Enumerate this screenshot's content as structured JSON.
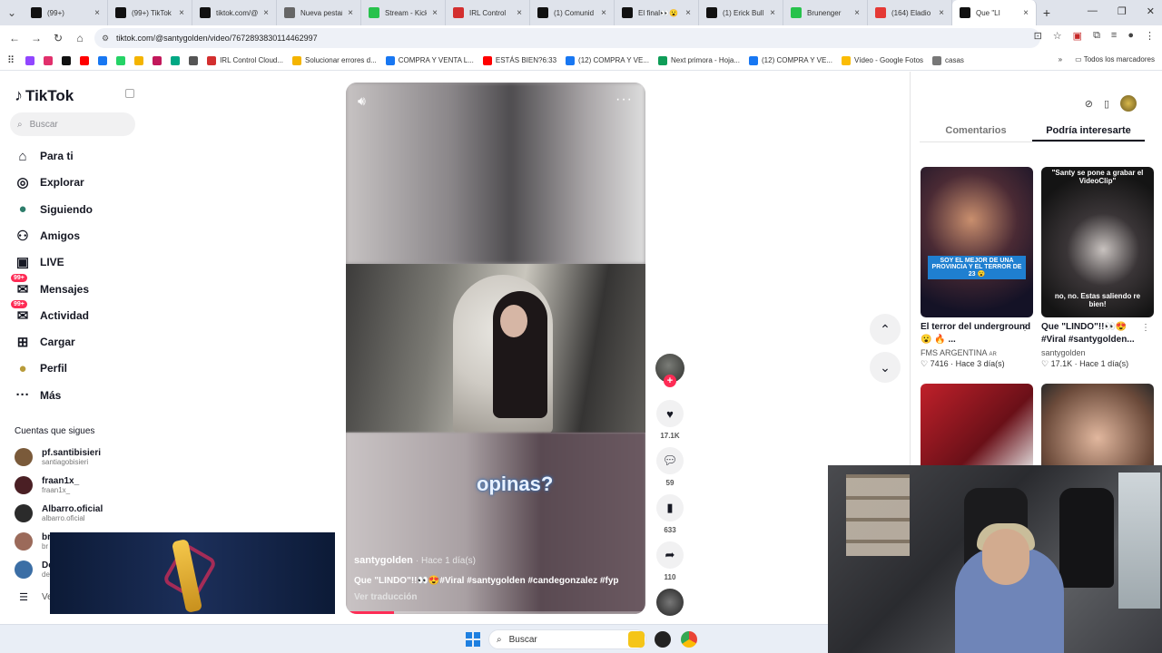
{
  "browser": {
    "tabs": [
      {
        "label": "(99+)",
        "color": "#111"
      },
      {
        "label": "(99+) TikTok",
        "color": "#111"
      },
      {
        "label": "tiktok.com/@",
        "color": "#111"
      },
      {
        "label": "Nueva pestaña",
        "color": "#666"
      },
      {
        "label": "Stream - Kick",
        "color": "#27c24c"
      },
      {
        "label": "IRL Control",
        "color": "#d32f2f"
      },
      {
        "label": "(1) Comunid",
        "color": "#111"
      },
      {
        "label": "El final👀😮",
        "color": "#111"
      },
      {
        "label": "(1) Erick Bull",
        "color": "#111"
      },
      {
        "label": "Brunenger",
        "color": "#27c24c"
      },
      {
        "label": "(164) Eladio",
        "color": "#e53935"
      },
      {
        "label": "Que \"LI",
        "color": "#111",
        "active": true
      }
    ],
    "url": "tiktok.com/@santygolden/video/7672893830114462997",
    "bookmarks": [
      {
        "label": "",
        "color": "#9146ff"
      },
      {
        "label": "",
        "color": "#e1306c"
      },
      {
        "label": "",
        "color": "#111"
      },
      {
        "label": "",
        "color": "#ff0000"
      },
      {
        "label": "",
        "color": "#1877f2"
      },
      {
        "label": "",
        "color": "#25d366"
      },
      {
        "label": "",
        "color": "#f4b400"
      },
      {
        "label": "",
        "color": "#c2185b"
      },
      {
        "label": "",
        "color": "#00a884"
      },
      {
        "label": "",
        "color": "#555"
      },
      {
        "label": "IRL Control Cloud...",
        "color": "#d32f2f"
      },
      {
        "label": "Solucionar errores d...",
        "color": "#f4b400"
      },
      {
        "label": "COMPRA Y VENTA L...",
        "color": "#1877f2"
      },
      {
        "label": "ESTÁS BIEN?6:33",
        "color": "#ff0000"
      },
      {
        "label": "(12) COMPRA Y VE...",
        "color": "#1877f2"
      },
      {
        "label": "Next primora - Hoja...",
        "color": "#0f9d58"
      },
      {
        "label": "(12) COMPRA Y VE...",
        "color": "#1877f2"
      },
      {
        "label": "Vídeo - Google Fotos",
        "color": "#fbbc04"
      },
      {
        "label": "casas",
        "color": "#777"
      }
    ],
    "bookmarks_all": "Todos los marcadores"
  },
  "sidebar": {
    "logo": "TikTok",
    "search_placeholder": "Buscar",
    "nav": [
      {
        "label": "Para ti",
        "icon": "home-icon"
      },
      {
        "label": "Explorar",
        "icon": "compass-icon"
      },
      {
        "label": "Siguiendo",
        "icon": "following-avatar-icon"
      },
      {
        "label": "Amigos",
        "icon": "friends-icon"
      },
      {
        "label": "LIVE",
        "icon": "live-icon"
      },
      {
        "label": "Mensajes",
        "icon": "messages-icon",
        "badge": "99+"
      },
      {
        "label": "Actividad",
        "icon": "activity-icon",
        "badge": "99+"
      },
      {
        "label": "Cargar",
        "icon": "upload-icon"
      },
      {
        "label": "Perfil",
        "icon": "profile-icon"
      },
      {
        "label": "Más",
        "icon": "more-icon"
      }
    ],
    "following_title": "Cuentas que sigues",
    "following": [
      {
        "name": "pf.santibisieri",
        "handle": "santiagobisieri",
        "color": "#7a5a3a"
      },
      {
        "name": "fraan1x_",
        "handle": "fraan1x_",
        "color": "#4a1f24"
      },
      {
        "name": "Albarro.oficial",
        "handle": "albarro.oficial",
        "color": "#2b2b2b"
      },
      {
        "name": "br",
        "handle": "br",
        "color": "#9b6a5a"
      },
      {
        "name": "De",
        "handle": "de",
        "color": "#3b6ea5"
      }
    ],
    "see_more": "Ve"
  },
  "video": {
    "overlay_text": "opinas?",
    "author": "santygolden",
    "time": "Hace 1 día(s)",
    "caption": "Que \"LINDO\"!!👀😍#Viral #santygolden #candegonzalez #fyp",
    "translate": "Ver traducción",
    "progress": 0.16
  },
  "actions": {
    "likes": "17.1K",
    "comments": "59",
    "saves": "633",
    "shares": "110"
  },
  "right_panel": {
    "tabs": [
      "Comentarios",
      "Podría interesarte"
    ],
    "active_tab": 1,
    "cards": [
      {
        "thumb_text": "SOY EL MEJOR DE UNA PROVINCIA Y EL TERROR DE 23 😮",
        "title": "El terror del underground 😮 🔥 ...",
        "author": "FMS ARGENTINA",
        "author_suffix": "AR",
        "likes": "7416",
        "time": "Hace 3 día(s)"
      },
      {
        "thumb_text": "\"Santy se pone a grabar el VideoClip\"",
        "thumb_text2": "no, no. Estas saliendo re bien!",
        "title": "Que \"LINDO\"!!👀😍 #Viral #santygolden...",
        "author": "santygolden",
        "likes": "17.1K",
        "time": "Hace 1 día(s)"
      }
    ]
  },
  "taskbar": {
    "search": "Buscar"
  }
}
